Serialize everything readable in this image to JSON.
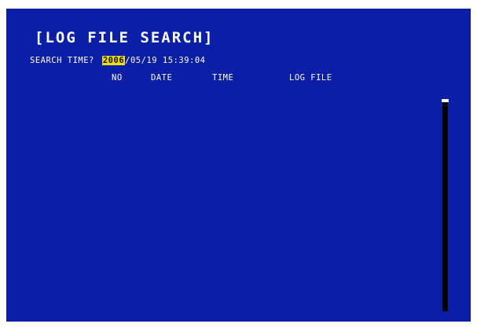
{
  "screen": {
    "title": "[LOG FILE SEARCH]",
    "search": {
      "label": "SEARCH TIME?",
      "year": "2006",
      "rest": "/05/19 15:39:04"
    },
    "columns": {
      "no": "NO",
      "date": "DATE",
      "time": "TIME",
      "log_file": "LOG FILE"
    },
    "colors": {
      "background": "#0a1ea8",
      "text": "#ffffff",
      "highlight": "#f0e000",
      "scrollbar": "#000000"
    }
  }
}
